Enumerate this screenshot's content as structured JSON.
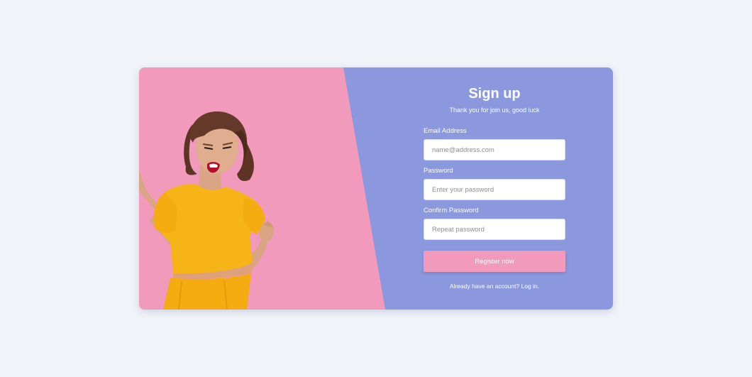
{
  "colors": {
    "page_background": "#f0f3f8",
    "form_panel": "#8c98de",
    "image_panel": "#f29abb",
    "register_button": "#f29abb",
    "dress": "#f6b416"
  },
  "signup": {
    "title": "Sign up",
    "subtitle": "Thank you for join us, good luck",
    "email_label": "Email Address",
    "email_placeholder": "name@address.com",
    "password_label": "Password",
    "password_placeholder": "Enter your password",
    "confirm_label": "Confirm Password",
    "confirm_placeholder": "Repeat password",
    "register_label": "Register now",
    "account_prompt": "Already have an account? ",
    "login_link": "Log in."
  }
}
